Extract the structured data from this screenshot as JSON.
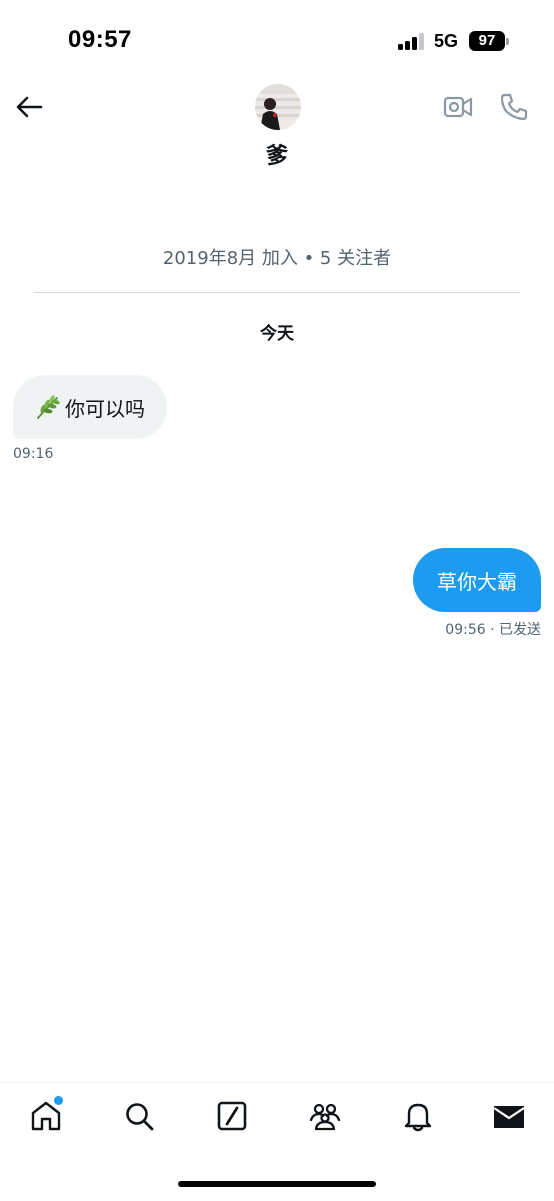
{
  "status_bar": {
    "time": "09:57",
    "network": "5G",
    "battery": "97"
  },
  "header": {
    "name": "爹",
    "icons": {
      "back": "arrow-left-icon",
      "video": "video-camera-icon",
      "call": "phone-icon"
    }
  },
  "profile_info": {
    "join_text": "2019年8月 加入 • 5 关注者"
  },
  "conversation": {
    "date_separator": "今天",
    "messages": [
      {
        "direction": "incoming",
        "emoji": "herb-leaf",
        "text": "你可以吗",
        "time": "09:16"
      },
      {
        "direction": "outgoing",
        "text": "草你大霸",
        "meta": "09:56 · 已发送"
      }
    ]
  },
  "bottom_nav": {
    "items": [
      {
        "icon": "home-icon",
        "has_notification_dot": true
      },
      {
        "icon": "search-icon"
      },
      {
        "icon": "grok-icon"
      },
      {
        "icon": "communities-icon"
      },
      {
        "icon": "bell-icon"
      },
      {
        "icon": "mail-icon",
        "active": true
      }
    ]
  },
  "colors": {
    "accent": "#1d9bf0",
    "incoming_bubble": "#eff3f4",
    "secondary_text": "#536471"
  }
}
